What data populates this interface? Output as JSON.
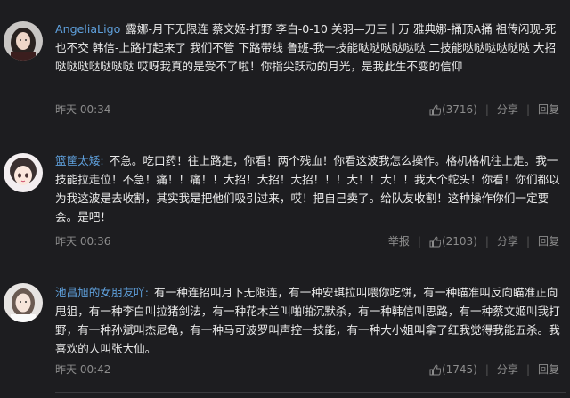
{
  "comments": [
    {
      "username": "AngeliaLigo",
      "text": "露娜-月下无限连 蔡文姬-打野 李白-0-10 关羽—刀三十万 雅典娜-捅顶A捅 祖传闪现-死也不交 韩信-上路打起来了 我们不管 下路带线 鲁班-我一技能哒哒哒哒哒哒 二技能哒哒哒哒哒哒 大招哒哒哒哒哒哒哒 哎呀我真的是受不了啦！你指尖跃动的月光，是我此生不变的信仰",
      "time": "昨天 00:34",
      "likes": "(3716)",
      "share": "分享",
      "reply": "回复"
    },
    {
      "username": "篮筐太矮:",
      "text": "不急。吃口药！往上路走，你看！两个残血！你看这波我怎么操作。格机格机往上走。我一技能拉走位！不急！痛！！痛！！大招！大招！大招！！！大！！大！！我大个蛇头！你看！你们都以为我这波是去收割，其实我是把他们吸引过来，哎！把自己卖了。给队友收割！这种操作你们一定要会。是吧！",
      "time": "昨天 00:36",
      "report": "举报",
      "likes": "(2103)",
      "share": "分享",
      "reply": "回复"
    },
    {
      "username": "池昌旭的女朋友吖:",
      "text": "有一种连招叫月下无限连，有一种安琪拉叫喂你吃饼，有一种瞄准叫反向瞄准正向甩狙，有一种李白叫拉猪剑法，有一种花木兰叫啪啪沉默杀，有一种韩信叫思路，有一种蔡文姬叫我打野，有一种孙斌叫杰尼龟，有一种马可波罗叫声控一技能，有一种大小姐叫拿了红我觉得我能五杀。我喜欢的人叫张大仙。",
      "time": "昨天 00:42",
      "likes": "(1745)",
      "share": "分享",
      "reply": "回复"
    }
  ],
  "colors": {
    "background": "#1d1d20",
    "username": "#5fa0dc",
    "text": "#e9e9e9",
    "meta": "#8c8c8c"
  },
  "icons": [
    "avatar-girl-dark-hair",
    "avatar-anime-girl",
    "avatar-girl-white",
    "thumbs-up-icon"
  ]
}
